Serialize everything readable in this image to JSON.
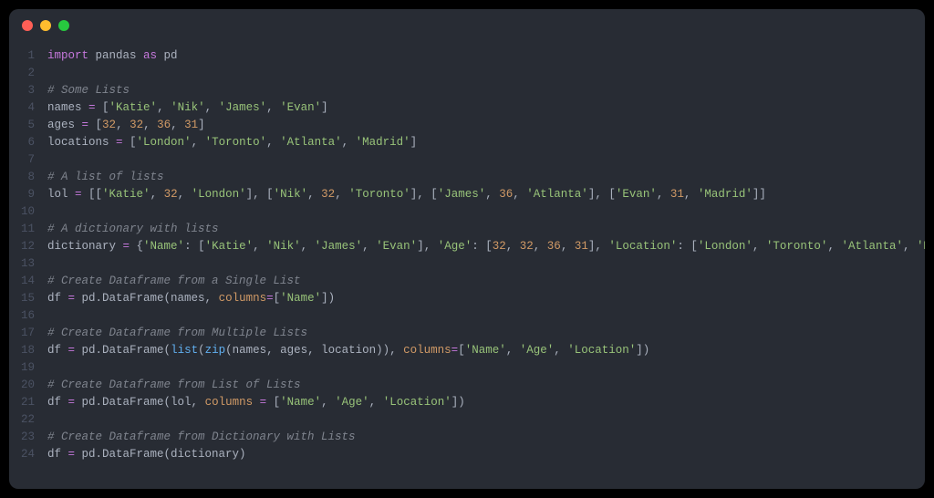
{
  "colors": {
    "bg": "#282c34",
    "red": "#ff5f56",
    "yellow": "#ffbd2e",
    "green": "#27c93f",
    "keyword": "#c678dd",
    "string": "#98c379",
    "number": "#d19a66",
    "function": "#61afef",
    "class": "#e5c07b",
    "comment": "#7f848e",
    "variable": "#e06c75",
    "text": "#abb2bf",
    "gutter": "#4b5263"
  },
  "code_lines": [
    {
      "n": 1,
      "t": [
        [
          "kw",
          "import"
        ],
        [
          "pn",
          " pandas "
        ],
        [
          "kw",
          "as"
        ],
        [
          "pn",
          " pd"
        ]
      ]
    },
    {
      "n": 2,
      "t": []
    },
    {
      "n": 3,
      "t": [
        [
          "cmt",
          "# Some Lists"
        ]
      ]
    },
    {
      "n": 4,
      "t": [
        [
          "pn",
          "names "
        ],
        [
          "op",
          "="
        ],
        [
          "pn",
          " ["
        ],
        [
          "str",
          "'Katie'"
        ],
        [
          "pn",
          ", "
        ],
        [
          "str",
          "'Nik'"
        ],
        [
          "pn",
          ", "
        ],
        [
          "str",
          "'James'"
        ],
        [
          "pn",
          ", "
        ],
        [
          "str",
          "'Evan'"
        ],
        [
          "pn",
          "]"
        ]
      ]
    },
    {
      "n": 5,
      "t": [
        [
          "pn",
          "ages "
        ],
        [
          "op",
          "="
        ],
        [
          "pn",
          " ["
        ],
        [
          "num",
          "32"
        ],
        [
          "pn",
          ", "
        ],
        [
          "num",
          "32"
        ],
        [
          "pn",
          ", "
        ],
        [
          "num",
          "36"
        ],
        [
          "pn",
          ", "
        ],
        [
          "num",
          "31"
        ],
        [
          "pn",
          "]"
        ]
      ]
    },
    {
      "n": 6,
      "t": [
        [
          "pn",
          "locations "
        ],
        [
          "op",
          "="
        ],
        [
          "pn",
          " ["
        ],
        [
          "str",
          "'London'"
        ],
        [
          "pn",
          ", "
        ],
        [
          "str",
          "'Toronto'"
        ],
        [
          "pn",
          ", "
        ],
        [
          "str",
          "'Atlanta'"
        ],
        [
          "pn",
          ", "
        ],
        [
          "str",
          "'Madrid'"
        ],
        [
          "pn",
          "]"
        ]
      ]
    },
    {
      "n": 7,
      "t": []
    },
    {
      "n": 8,
      "t": [
        [
          "cmt",
          "# A list of lists"
        ]
      ]
    },
    {
      "n": 9,
      "t": [
        [
          "pn",
          "lol "
        ],
        [
          "op",
          "="
        ],
        [
          "pn",
          " [["
        ],
        [
          "str",
          "'Katie'"
        ],
        [
          "pn",
          ", "
        ],
        [
          "num",
          "32"
        ],
        [
          "pn",
          ", "
        ],
        [
          "str",
          "'London'"
        ],
        [
          "pn",
          "], ["
        ],
        [
          "str",
          "'Nik'"
        ],
        [
          "pn",
          ", "
        ],
        [
          "num",
          "32"
        ],
        [
          "pn",
          ", "
        ],
        [
          "str",
          "'Toronto'"
        ],
        [
          "pn",
          "], ["
        ],
        [
          "str",
          "'James'"
        ],
        [
          "pn",
          ", "
        ],
        [
          "num",
          "36"
        ],
        [
          "pn",
          ", "
        ],
        [
          "str",
          "'Atlanta'"
        ],
        [
          "pn",
          "], ["
        ],
        [
          "str",
          "'Evan'"
        ],
        [
          "pn",
          ", "
        ],
        [
          "num",
          "31"
        ],
        [
          "pn",
          ", "
        ],
        [
          "str",
          "'Madrid'"
        ],
        [
          "pn",
          "]]"
        ]
      ]
    },
    {
      "n": 10,
      "t": []
    },
    {
      "n": 11,
      "t": [
        [
          "cmt",
          "# A dictionary with lists"
        ]
      ]
    },
    {
      "n": 12,
      "t": [
        [
          "pn",
          "dictionary "
        ],
        [
          "op",
          "="
        ],
        [
          "pn",
          " {"
        ],
        [
          "str",
          "'Name'"
        ],
        [
          "pn",
          ": ["
        ],
        [
          "str",
          "'Katie'"
        ],
        [
          "pn",
          ", "
        ],
        [
          "str",
          "'Nik'"
        ],
        [
          "pn",
          ", "
        ],
        [
          "str",
          "'James'"
        ],
        [
          "pn",
          ", "
        ],
        [
          "str",
          "'Evan'"
        ],
        [
          "pn",
          "], "
        ],
        [
          "str",
          "'Age'"
        ],
        [
          "pn",
          ": ["
        ],
        [
          "num",
          "32"
        ],
        [
          "pn",
          ", "
        ],
        [
          "num",
          "32"
        ],
        [
          "pn",
          ", "
        ],
        [
          "num",
          "36"
        ],
        [
          "pn",
          ", "
        ],
        [
          "num",
          "31"
        ],
        [
          "pn",
          "], "
        ],
        [
          "str",
          "'Location'"
        ],
        [
          "pn",
          ": ["
        ],
        [
          "str",
          "'London'"
        ],
        [
          "pn",
          ", "
        ],
        [
          "str",
          "'Toronto'"
        ],
        [
          "pn",
          ", "
        ],
        [
          "str",
          "'Atlanta'"
        ],
        [
          "pn",
          ", "
        ],
        [
          "str",
          "'Madrid'"
        ],
        [
          "pn",
          "]}"
        ]
      ]
    },
    {
      "n": 13,
      "t": []
    },
    {
      "n": 14,
      "t": [
        [
          "cmt",
          "# Create Dataframe from a Single List"
        ]
      ]
    },
    {
      "n": 15,
      "t": [
        [
          "pn",
          "df "
        ],
        [
          "op",
          "="
        ],
        [
          "pn",
          " pd.DataFrame(names, "
        ],
        [
          "param",
          "columns"
        ],
        [
          "op",
          "="
        ],
        [
          "pn",
          "["
        ],
        [
          "str",
          "'Name'"
        ],
        [
          "pn",
          "])"
        ]
      ]
    },
    {
      "n": 16,
      "t": []
    },
    {
      "n": 17,
      "t": [
        [
          "cmt",
          "# Create Dataframe from Multiple Lists"
        ]
      ]
    },
    {
      "n": 18,
      "t": [
        [
          "pn",
          "df "
        ],
        [
          "op",
          "="
        ],
        [
          "pn",
          " pd.DataFrame("
        ],
        [
          "fn",
          "list"
        ],
        [
          "pn",
          "("
        ],
        [
          "fn",
          "zip"
        ],
        [
          "pn",
          "(names, ages, location)), "
        ],
        [
          "param",
          "columns"
        ],
        [
          "op",
          "="
        ],
        [
          "pn",
          "["
        ],
        [
          "str",
          "'Name'"
        ],
        [
          "pn",
          ", "
        ],
        [
          "str",
          "'Age'"
        ],
        [
          "pn",
          ", "
        ],
        [
          "str",
          "'Location'"
        ],
        [
          "pn",
          "])"
        ]
      ]
    },
    {
      "n": 19,
      "t": []
    },
    {
      "n": 20,
      "t": [
        [
          "cmt",
          "# Create Dataframe from List of Lists"
        ]
      ]
    },
    {
      "n": 21,
      "t": [
        [
          "pn",
          "df "
        ],
        [
          "op",
          "="
        ],
        [
          "pn",
          " pd.DataFrame(lol, "
        ],
        [
          "param",
          "columns"
        ],
        [
          "pn",
          " "
        ],
        [
          "op",
          "="
        ],
        [
          "pn",
          " ["
        ],
        [
          "str",
          "'Name'"
        ],
        [
          "pn",
          ", "
        ],
        [
          "str",
          "'Age'"
        ],
        [
          "pn",
          ", "
        ],
        [
          "str",
          "'Location'"
        ],
        [
          "pn",
          "])"
        ]
      ]
    },
    {
      "n": 22,
      "t": []
    },
    {
      "n": 23,
      "t": [
        [
          "cmt",
          "# Create Dataframe from Dictionary with Lists"
        ]
      ]
    },
    {
      "n": 24,
      "t": [
        [
          "pn",
          "df "
        ],
        [
          "op",
          "="
        ],
        [
          "pn",
          " pd.DataFrame(dictionary)"
        ]
      ]
    }
  ]
}
